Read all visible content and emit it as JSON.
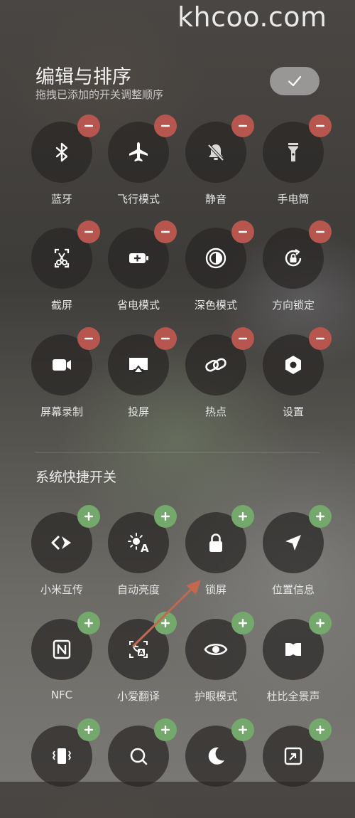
{
  "watermark": "khcoo.com",
  "header": {
    "title": "编辑与排序",
    "subtitle": "拖拽已添加的开关调整顺序"
  },
  "added_tiles": [
    {
      "label": "蓝牙",
      "icon": "bluetooth-icon"
    },
    {
      "label": "飞行模式",
      "icon": "airplane-icon"
    },
    {
      "label": "静音",
      "icon": "bell-off-icon"
    },
    {
      "label": "手电筒",
      "icon": "flashlight-icon"
    },
    {
      "label": "截屏",
      "icon": "screenshot-icon"
    },
    {
      "label": "省电模式",
      "icon": "battery-saver-icon"
    },
    {
      "label": "深色模式",
      "icon": "dark-mode-icon"
    },
    {
      "label": "方向锁定",
      "icon": "rotation-lock-icon"
    },
    {
      "label": "屏幕录制",
      "icon": "screen-record-icon"
    },
    {
      "label": "投屏",
      "icon": "cast-icon"
    },
    {
      "label": "热点",
      "icon": "hotspot-icon"
    },
    {
      "label": "设置",
      "icon": "settings-icon"
    }
  ],
  "system_section": {
    "title": "系统快捷开关",
    "tiles": [
      {
        "label": "小米互传",
        "icon": "mi-share-icon"
      },
      {
        "label": "自动亮度",
        "icon": "auto-brightness-icon"
      },
      {
        "label": "锁屏",
        "icon": "lock-icon"
      },
      {
        "label": "位置信息",
        "icon": "location-icon"
      },
      {
        "label": "NFC",
        "icon": "nfc-icon"
      },
      {
        "label": "小爱翻译",
        "icon": "translate-icon"
      },
      {
        "label": "护眼模式",
        "icon": "eye-icon"
      },
      {
        "label": "杜比全景声",
        "icon": "dolby-icon"
      },
      {
        "label": "",
        "icon": "vibrate-icon"
      },
      {
        "label": "",
        "icon": "search-icon"
      },
      {
        "label": "",
        "icon": "moon-icon"
      },
      {
        "label": "",
        "icon": "resize-icon"
      }
    ]
  },
  "colors": {
    "remove_badge": "#b6564e",
    "add_badge": "#74a86c",
    "arrow_annotation": "#c0694f"
  }
}
